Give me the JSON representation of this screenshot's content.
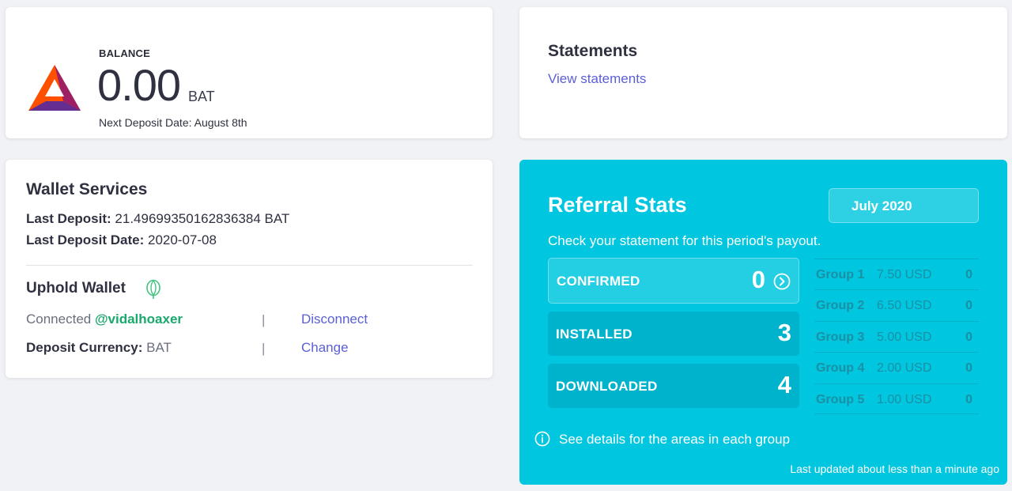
{
  "balance": {
    "label": "BALANCE",
    "amount": "0.00",
    "unit": "BAT",
    "next_deposit": "Next Deposit Date: August 8th"
  },
  "statements": {
    "title": "Statements",
    "link": "View statements"
  },
  "wallet": {
    "title": "Wallet Services",
    "last_deposit_label": "Last Deposit:",
    "last_deposit_value": "21.49699350162836384 BAT",
    "last_deposit_date_label": "Last Deposit Date:",
    "last_deposit_date_value": "2020-07-08",
    "uphold_title": "Uphold Wallet",
    "connected_prefix": "Connected",
    "connected_user": "@vidalhoaxer",
    "separator": "|",
    "disconnect": "Disconnect",
    "currency_label": "Deposit Currency:",
    "currency_value": "BAT",
    "change": "Change"
  },
  "referral": {
    "title": "Referral Stats",
    "month": "July 2020",
    "subtitle": "Check your statement for this period's payout.",
    "stats": [
      {
        "label": "CONFIRMED",
        "value": "0"
      },
      {
        "label": "INSTALLED",
        "value": "3"
      },
      {
        "label": "DOWNLOADED",
        "value": "4"
      }
    ],
    "groups": [
      {
        "name": "Group 1",
        "amount": "7.50 USD",
        "count": "0"
      },
      {
        "name": "Group 2",
        "amount": "6.50 USD",
        "count": "0"
      },
      {
        "name": "Group 3",
        "amount": "5.00 USD",
        "count": "0"
      },
      {
        "name": "Group 4",
        "amount": "2.00 USD",
        "count": "0"
      },
      {
        "name": "Group 5",
        "amount": "1.00 USD",
        "count": "0"
      }
    ],
    "details": "See details for the areas in each group",
    "last_updated": "Last updated about less than a minute ago"
  },
  "colors": {
    "accent": "#5b5fd4",
    "referral_bg": "#00c6df",
    "connected": "#1aa86b"
  },
  "icons": {
    "logo": "bat-logo-icon",
    "uphold": "uphold-icon",
    "chevron": "chevron-right-circle-icon",
    "info": "info-icon"
  }
}
